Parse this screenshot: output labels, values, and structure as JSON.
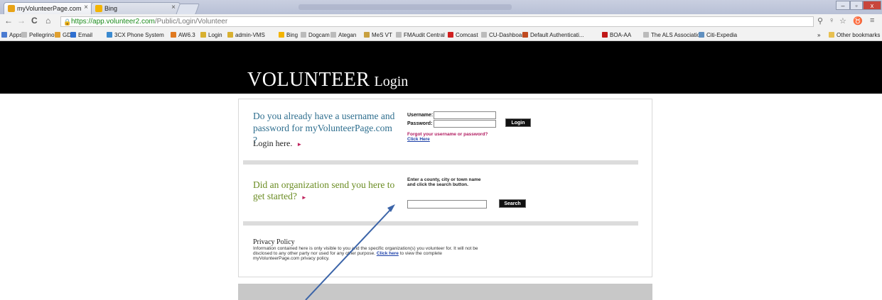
{
  "browser": {
    "tabs": [
      {
        "title": "myVolunteerPage.com",
        "close": "×",
        "favicon_color": "#e8a317"
      },
      {
        "title": "Bing",
        "close": "×",
        "favicon_color": "#f4b400"
      }
    ],
    "url_scheme": "https://",
    "url_host": "app.volunteer2.com",
    "url_path": "/Public/Login/Volunteer",
    "bookmarks": [
      {
        "label": "Apps",
        "color": "#4a7bd1"
      },
      {
        "label": "Pellegrino's",
        "color": "#bbbbbb"
      },
      {
        "label": "GD",
        "color": "#e0a030"
      },
      {
        "label": "Email",
        "color": "#2f6fd0"
      },
      {
        "label": "3CX Phone System",
        "color": "#3a8ad0"
      },
      {
        "label": "AW6.3",
        "color": "#e07a20"
      },
      {
        "label": "Login",
        "color": "#d8b030"
      },
      {
        "label": "admin-VMS",
        "color": "#d8b030"
      },
      {
        "label": "Bing",
        "color": "#f4b400"
      },
      {
        "label": "Dogcam",
        "color": "#bbbbbb"
      },
      {
        "label": "Ategan",
        "color": "#bbbbbb"
      },
      {
        "label": "MeS VT",
        "color": "#c8a040"
      },
      {
        "label": "FMAudit Central",
        "color": "#bbbbbb"
      },
      {
        "label": "Comcast",
        "color": "#d02020"
      },
      {
        "label": "CU-Dashboard",
        "color": "#bbbbbb"
      },
      {
        "label": "Default Authenticati...",
        "color": "#c04a20"
      },
      {
        "label": "BOA-AA",
        "color": "#c01818"
      },
      {
        "label": "The ALS Association",
        "color": "#bbbbbb"
      },
      {
        "label": "Citi-Expedia",
        "color": "#6090c0"
      }
    ],
    "overflow": "»",
    "other_bookmarks": "Other bookmarks",
    "window_buttons": {
      "minimize": "–",
      "maximize": "▫",
      "close": "x"
    }
  },
  "page": {
    "brand_big": "VOLUNTEER",
    "brand_small": "Login",
    "login_question": "Do you already have a username and password for myVolunteerPage.com ?",
    "login_here": "Login here.",
    "username_label": "Username:",
    "password_label": "Password:",
    "login_button": "Login",
    "forgot_text": "Forgot your username or password?",
    "click_here": "Click Here",
    "org_question": "Did an organization send you here to get started?",
    "search_instructions": "Enter a county, city or town name and click the search button.",
    "search_button": "Search",
    "privacy_title": "Privacy Policy",
    "privacy_text_1": "Information contained here is only visible to you and the specific organization(s) you volunteer for. It will not be disclosed to any other party nor used for any other purpose.",
    "privacy_link": "Click here",
    "privacy_text_2": "to view the complete myVolunteerPage.com privacy policy."
  },
  "colors": {
    "login_question": "#2e6e8e",
    "org_question": "#6a8c22",
    "arrow": "#c0245e",
    "annotation_arrow": "#3b64a8"
  }
}
